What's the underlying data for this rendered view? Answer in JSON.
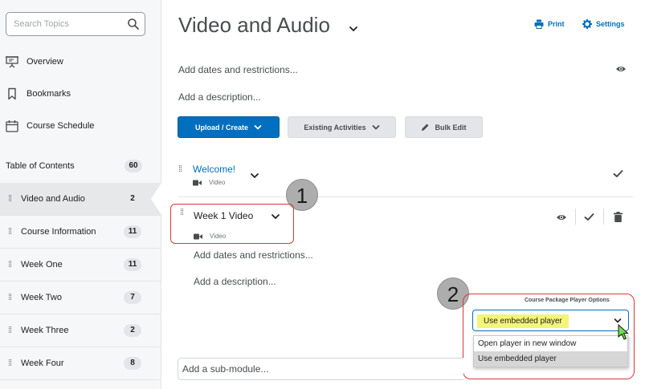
{
  "sidebar": {
    "search_placeholder": "Search Topics",
    "links": [
      {
        "label": "Overview",
        "icon": "presentation-icon"
      },
      {
        "label": "Bookmarks",
        "icon": "bookmark-icon"
      },
      {
        "label": "Course Schedule",
        "icon": "calendar-icon"
      }
    ],
    "toc": {
      "label": "Table of Contents",
      "count": "60"
    },
    "items": [
      {
        "label": "Video and Audio",
        "count": "2"
      },
      {
        "label": "Course Information",
        "count": "11"
      },
      {
        "label": "Week One",
        "count": "11"
      },
      {
        "label": "Week Two",
        "count": "7"
      },
      {
        "label": "Week Three",
        "count": "2"
      },
      {
        "label": "Week Four",
        "count": "8"
      }
    ]
  },
  "header": {
    "title": "Video and Audio",
    "print_label": "Print",
    "settings_label": "Settings"
  },
  "module": {
    "add_dates": "Add dates and restrictions...",
    "add_description": "Add a description...",
    "upload_label": "Upload / Create",
    "existing_label": "Existing Activities",
    "bulk_label": "Bulk Edit"
  },
  "topics": [
    {
      "title": "Welcome!",
      "type": "Video"
    },
    {
      "title": "Week 1 Video",
      "type": "Video"
    }
  ],
  "topic_detail": {
    "add_dates": "Add dates and restrictions...",
    "add_description": "Add a description...",
    "player_options_label": "Course Package Player Options",
    "selected_option": "Use embedded player",
    "options": [
      "Open player in new window",
      "Use embedded player"
    ],
    "submodule_placeholder": "Add a sub-module..."
  },
  "callouts": [
    "1",
    "2"
  ],
  "colors": {
    "accent": "#006fbf",
    "highlight": "#f4f47a",
    "annotation": "#d43a3a"
  }
}
